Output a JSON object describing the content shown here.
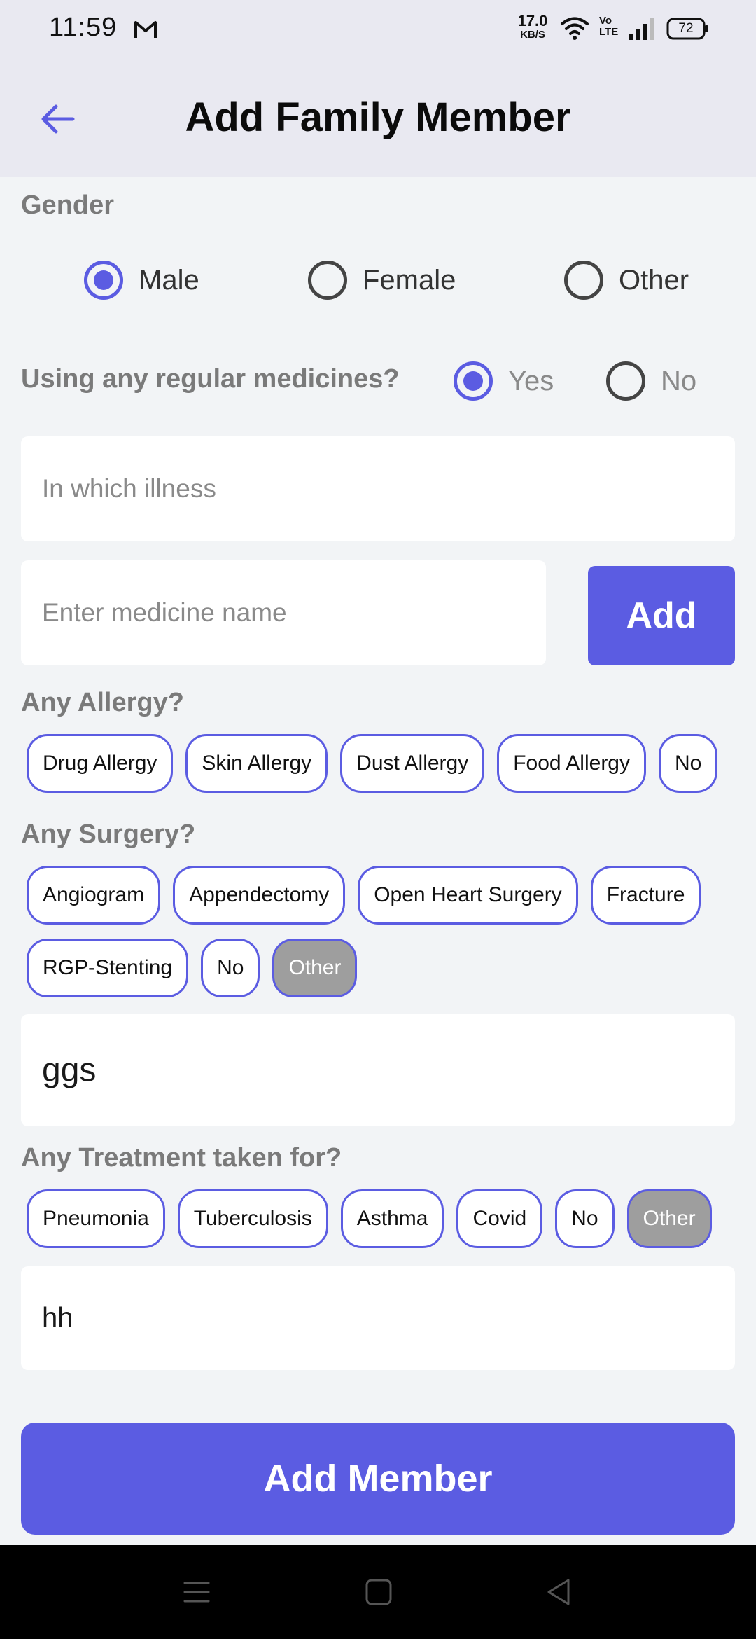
{
  "status": {
    "time": "11:59",
    "speed_value": "17.0",
    "speed_unit": "KB/S",
    "volte": "Vo\nLTE",
    "battery": "72"
  },
  "header": {
    "title": "Add Family Member"
  },
  "gender": {
    "label": "Gender",
    "options": [
      "Male",
      "Female",
      "Other"
    ],
    "selected": "Male"
  },
  "medicines": {
    "label": "Using any regular medicines?",
    "options": [
      "Yes",
      "No"
    ],
    "selected": "Yes",
    "illness_placeholder": "In which illness",
    "medicine_placeholder": "Enter medicine name",
    "add_label": "Add"
  },
  "allergy": {
    "label": "Any Allergy?",
    "options": [
      "Drug Allergy",
      "Skin Allergy",
      "Dust Allergy",
      "Food Allergy",
      "No"
    ]
  },
  "surgery": {
    "label": "Any Surgery?",
    "options": [
      "Angiogram",
      "Appendectomy",
      "Open Heart Surgery",
      "Fracture",
      "RGP-Stenting",
      "No",
      "Other"
    ],
    "selected": "Other",
    "other_value": "ggs"
  },
  "treatment": {
    "label": "Any Treatment taken for?",
    "options": [
      "Pneumonia",
      "Tuberculosis",
      "Asthma",
      "Covid",
      "No",
      "Other"
    ],
    "selected": "Other",
    "other_value": "hh"
  },
  "submit_label": "Add Member",
  "colors": {
    "accent": "#5b5ce2",
    "selected_chip": "#9e9e9e",
    "header_bg": "#e9e9f1"
  },
  "icons": {
    "back": "arrow-left-icon",
    "nav": [
      "menu-icon",
      "home-square-icon",
      "back-triangle-icon"
    ]
  }
}
